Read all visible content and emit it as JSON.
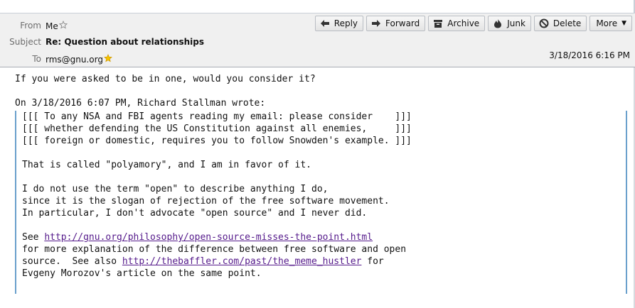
{
  "header": {
    "from_label": "From",
    "from_value": "Me",
    "subject_label": "Subject",
    "subject_value": "Re: Question about relationships",
    "to_label": "To",
    "to_value": "rms@gnu.org",
    "date": "3/18/2016 6:16 PM"
  },
  "toolbar": {
    "reply": "Reply",
    "forward": "Forward",
    "archive": "Archive",
    "junk": "Junk",
    "delete": "Delete",
    "more": "More"
  },
  "message": {
    "reply_line": "If you were asked to be in one, would you consider it?",
    "attribution": "On 3/18/2016 6:07 PM, Richard Stallman wrote:",
    "quote_lines_a": [
      "[[[ To any NSA and FBI agents reading my email: please consider    ]]]",
      "[[[ whether defending the US Constitution against all enemies,     ]]]",
      "[[[ foreign or domestic, requires you to follow Snowden's example. ]]]",
      "",
      "That is called \"polyamory\", and I am in favor of it.",
      "",
      "I do not use the term \"open\" to describe anything I do,",
      "since it is the slogan of rejection of the free software movement.",
      "In particular, I don't advocate \"open source\" and I never did.",
      ""
    ],
    "see_prefix": "See ",
    "link1": "http://gnu.org/philosophy/open-source-misses-the-point.html",
    "line_after_link1": "for more explanation of the difference between free software and open",
    "source_prefix": "source.  See also ",
    "link2": "http://thebaffler.com/past/the_meme_hustler",
    "link2_suffix": " for",
    "last_line": "Evgeny Morozov's article on the same point."
  },
  "colors": {
    "header_bg": "#f0f0f0",
    "quote_bar": "#6aa0cc",
    "link": "#551a8b",
    "star_yellow": "#f5c400"
  }
}
